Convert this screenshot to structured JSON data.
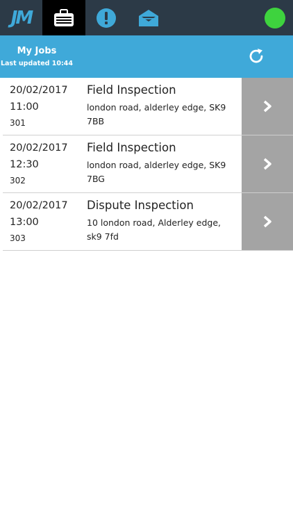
{
  "app": {
    "logo_text": "JM"
  },
  "nav": {
    "tabs": [
      {
        "name": "logo",
        "icon": "logo-icon"
      },
      {
        "name": "jobs",
        "icon": "briefcase-icon",
        "active": true
      },
      {
        "name": "alerts",
        "icon": "exclamation-icon"
      },
      {
        "name": "messages",
        "icon": "envelope-open-icon"
      }
    ],
    "status_color": "#3ed33e"
  },
  "header": {
    "title": "My Jobs",
    "last_updated": "Last updated 10:44",
    "refresh_icon": "refresh-icon"
  },
  "colors": {
    "topbar": "#2c3a47",
    "accent": "#3fa9d9",
    "active_tab": "#000000",
    "row_action": "#a4a4a4"
  },
  "jobs": [
    {
      "date": "20/02/2017",
      "time": "11:00",
      "id": "301",
      "title": "Field Inspection",
      "address": "london road, alderley edge, SK9 7BB"
    },
    {
      "date": "20/02/2017",
      "time": "12:30",
      "id": "302",
      "title": "Field Inspection",
      "address": "london road, alderley edge, SK9 7BG"
    },
    {
      "date": "20/02/2017",
      "time": "13:00",
      "id": "303",
      "title": "Dispute Inspection",
      "address": "10 london road, Alderley edge, sk9 7fd"
    }
  ]
}
